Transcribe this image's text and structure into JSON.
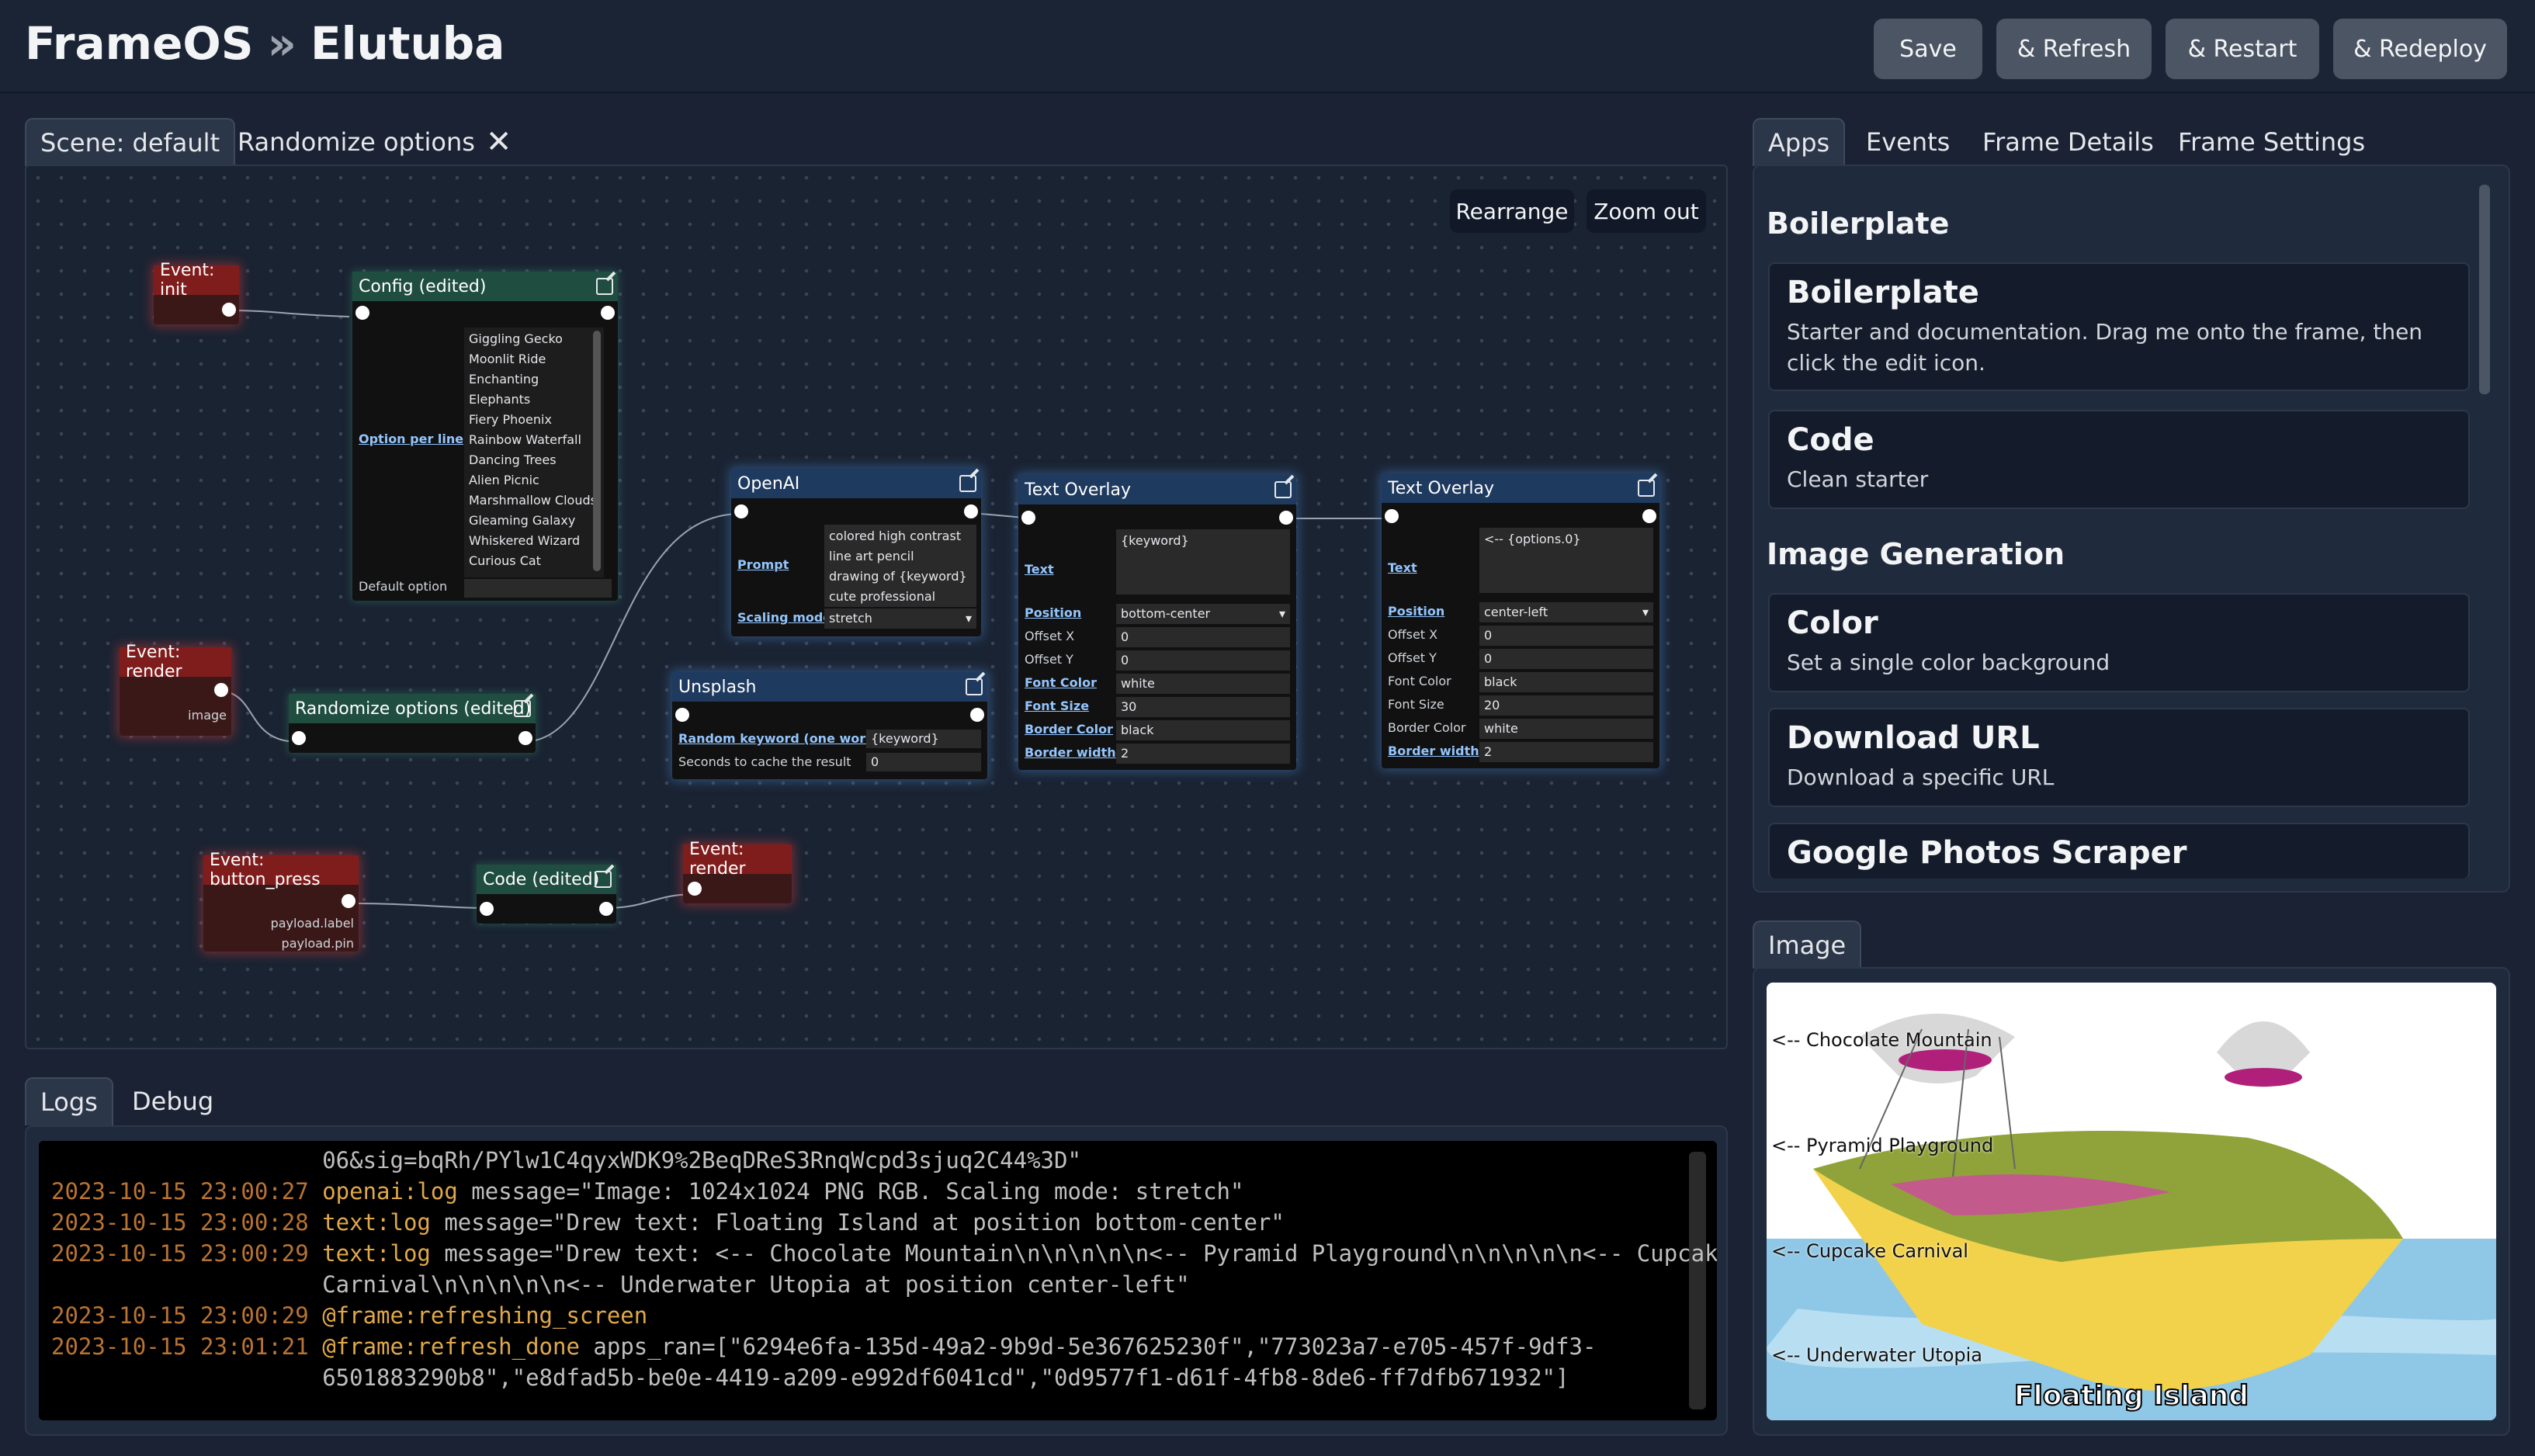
{
  "header": {
    "app_name": "FrameOS",
    "separator": "»",
    "frame_name": "Elutuba",
    "buttons": [
      "Save",
      "& Refresh",
      "& Restart",
      "& Redeploy"
    ]
  },
  "scene_tabs": {
    "active": "Scene: default",
    "other": "Randomize options"
  },
  "canvas_buttons": {
    "rearrange": "Rearrange",
    "zoom_out": "Zoom out"
  },
  "nodes": {
    "event_init": "Event: init",
    "config": {
      "title": "Config (edited)",
      "options": [
        "Giggling Gecko",
        "Moonlit Ride",
        "Enchanting",
        "Elephants",
        "Fiery Phoenix",
        "Rainbow Waterfall",
        "Dancing Trees",
        "Alien Picnic",
        "Marshmallow Clouds",
        "Gleaming Galaxy",
        "Whiskered Wizard",
        "Curious Cat"
      ],
      "option_label": "Option per line",
      "default_label": "Default option"
    },
    "event_render_1": {
      "title": "Event: render",
      "output": "image"
    },
    "randomize": "Randomize options (edited)",
    "openai": {
      "title": "OpenAI",
      "prompt_label": "Prompt",
      "prompt_value": "colored high contrast\nline art pencil\ndrawing of {keyword}\ncute professional",
      "scaling_label": "Scaling mode",
      "scaling_value": "stretch"
    },
    "unsplash": {
      "title": "Unsplash",
      "keyword_label": "Random keyword (one word)",
      "keyword_value": "{keyword}",
      "cache_label": "Seconds to cache the result",
      "cache_value": "0"
    },
    "text1": {
      "title": "Text Overlay",
      "text_label": "Text",
      "text_value": "{keyword}",
      "position_label": "Position",
      "position_value": "bottom-center",
      "offx_label": "Offset X",
      "offx_value": "0",
      "offy_label": "Offset Y",
      "offy_value": "0",
      "color_label": "Font Color",
      "color_value": "white",
      "size_label": "Font Size",
      "size_value": "30",
      "bcolor_label": "Border Color",
      "bcolor_value": "black",
      "bwidth_label": "Border width",
      "bwidth_value": "2"
    },
    "text2": {
      "title": "Text Overlay",
      "text_label": "Text",
      "text_value": "<-- {options.0}",
      "position_label": "Position",
      "position_value": "center-left",
      "offx_label": "Offset X",
      "offx_value": "0",
      "offy_label": "Offset Y",
      "offy_value": "0",
      "color_label": "Font Color",
      "color_value": "black",
      "size_label": "Font Size",
      "size_value": "20",
      "bcolor_label": "Border Color",
      "bcolor_value": "white",
      "bwidth_label": "Border width",
      "bwidth_value": "2"
    },
    "event_button": {
      "title": "Event: button_press",
      "out1": "payload.label",
      "out2": "payload.pin"
    },
    "code": "Code (edited)",
    "event_render_2": "Event: render"
  },
  "bottom_tabs": {
    "logs": "Logs",
    "debug": "Debug"
  },
  "logs": [
    {
      "ts": "",
      "src": "",
      "msg": "06&sig=bqRh/PYlw1C4qyxWDK9%2BeqDReS3RnqWcpd3sjuq2C44%3D\""
    },
    {
      "ts": "2023-10-15 23:00:27",
      "src": "openai:log",
      "msg": " message=\"Image: 1024x1024 PNG RGB. Scaling mode: stretch\""
    },
    {
      "ts": "2023-10-15 23:00:28",
      "src": "text:log",
      "msg": " message=\"Drew text: Floating Island at position bottom-center\""
    },
    {
      "ts": "2023-10-15 23:00:29",
      "src": "text:log",
      "msg": " message=\"Drew text: <-- Chocolate Mountain\\n\\n\\n\\n\\n<-- Pyramid Playground\\n\\n\\n\\n\\n<-- Cupcake"
    },
    {
      "ts": "",
      "src": "",
      "msg": "Carnival\\n\\n\\n\\n\\n<-- Underwater Utopia at position center-left\""
    },
    {
      "ts": "2023-10-15 23:00:29",
      "src": "@frame:refreshing_screen",
      "msg": ""
    },
    {
      "ts": "2023-10-15 23:01:21",
      "src": "@frame:refresh_done",
      "msg": " apps_ran=[\"6294e6fa-135d-49a2-9b9d-5e367625230f\",\"773023a7-e705-457f-9df3-"
    },
    {
      "ts": "",
      "src": "",
      "msg": "6501883290b8\",\"e8dfad5b-be0e-4419-a209-e992df6041cd\",\"0d9577f1-d61f-4fb8-8de6-ff7dfb671932\"]"
    }
  ],
  "right_tabs": [
    "Apps",
    "Events",
    "Frame Details",
    "Frame Settings"
  ],
  "apps": {
    "section1": "Boilerplate",
    "boilerplate": {
      "title": "Boilerplate",
      "desc": "Starter and documentation. Drag me onto the frame, then click the edit icon."
    },
    "code": {
      "title": "Code",
      "desc": "Clean starter"
    },
    "section2": "Image Generation",
    "color": {
      "title": "Color",
      "desc": "Set a single color background"
    },
    "download": {
      "title": "Download URL",
      "desc": "Download a specific URL"
    },
    "google": {
      "title": "Google Photos Scraper",
      "desc": ""
    }
  },
  "image_tab": "Image",
  "image_labels": [
    "<-- Chocolate Mountain",
    "<-- Pyramid Playground",
    "<-- Cupcake Carnival",
    "<-- Underwater Utopia"
  ],
  "image_caption": "Floating Island"
}
